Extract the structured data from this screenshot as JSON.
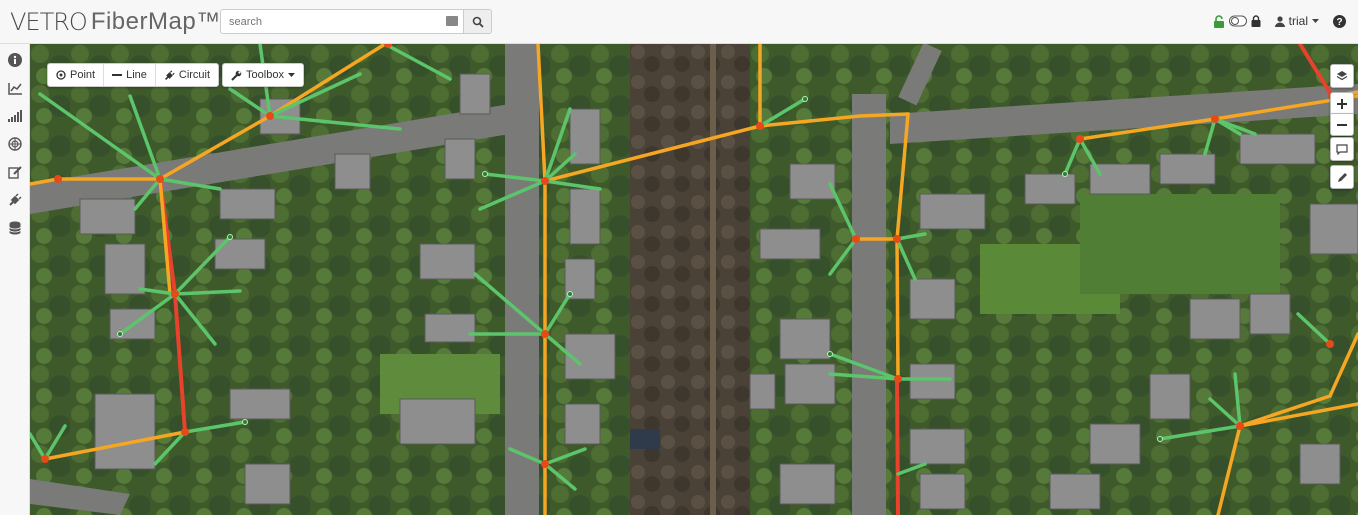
{
  "app": {
    "logo_brand": "VETRO",
    "logo_product": "FiberMap™"
  },
  "search": {
    "placeholder": "search",
    "value": ""
  },
  "user": {
    "name": "trial"
  },
  "toolbar": {
    "point_label": "Point",
    "line_label": "Line",
    "circuit_label": "Circuit",
    "toolbox_label": "Toolbox"
  },
  "sidebar": {
    "items": [
      "info-icon",
      "chart-line-icon",
      "signal-bars-icon",
      "globe-icon",
      "edit-icon",
      "plug-icon",
      "database-icon"
    ]
  },
  "map_controls": [
    "layers-icon",
    "zoom-in-icon",
    "zoom-out-icon",
    "comment-icon",
    "pencil-icon"
  ],
  "colors": {
    "orange_line": "#f5a623",
    "red_line": "#e8412c",
    "green_drop": "#5cc46a",
    "node": "#e64a19"
  }
}
